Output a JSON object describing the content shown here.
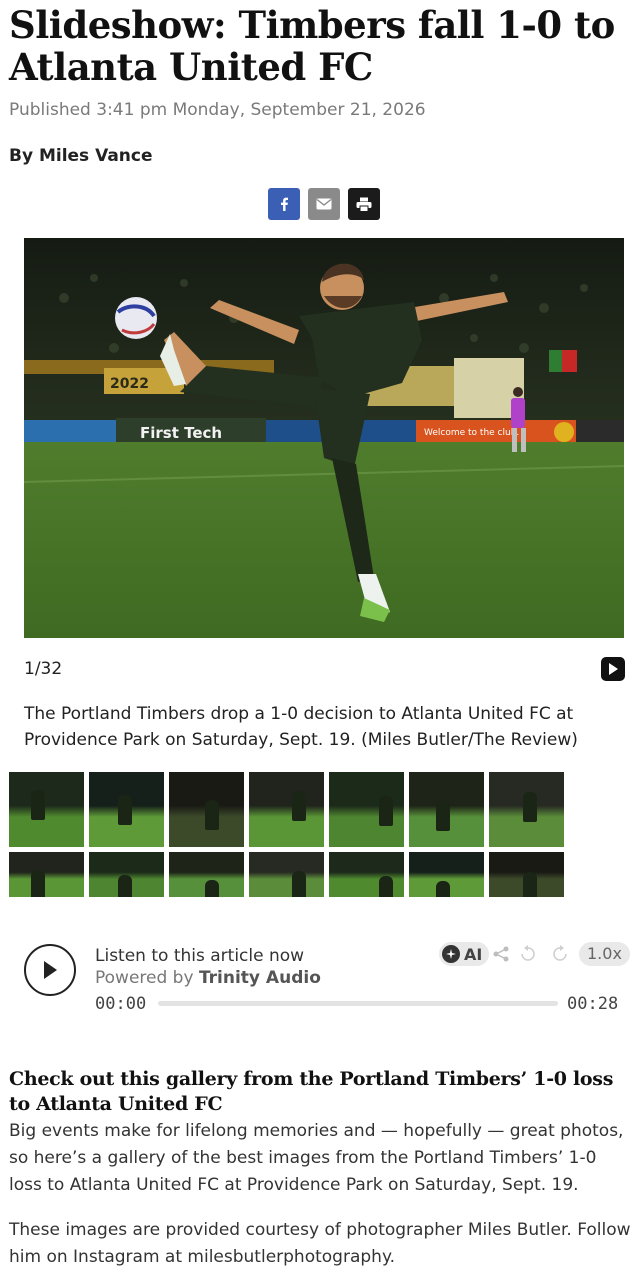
{
  "article": {
    "title": "Slideshow: Timbers fall 1-0 to Atlanta United FC",
    "published": "Published 3:41 pm Monday, September 21, 2026",
    "byline": "By Miles Vance"
  },
  "share": {
    "facebook_icon": "facebook-icon",
    "email_icon": "email-icon",
    "print_icon": "print-icon",
    "colors": {
      "facebook": "#3b5fb5",
      "email": "#8a8a8a",
      "print": "#1b1b1b"
    }
  },
  "gallery": {
    "counter": "1/32",
    "caption": "The Portland Timbers drop a 1-0 decision to Atlanta United FC at Providence Park on Saturday, Sept. 19. (Miles Butler/The Review)",
    "main_image": {
      "board_left": "First Tech",
      "board_year": "2022",
      "fence_text": "Welcome to the club."
    },
    "thumbnails_row1": [
      "thumb-1",
      "thumb-2",
      "thumb-3",
      "thumb-4",
      "thumb-5",
      "thumb-6",
      "thumb-7"
    ],
    "thumbnails_row2": [
      "thumb-8",
      "thumb-9",
      "thumb-10",
      "thumb-11",
      "thumb-12",
      "thumb-13",
      "thumb-14"
    ]
  },
  "audio_player": {
    "listen_label": "Listen to this article now",
    "powered_prefix": "Powered by",
    "powered_brand": "Trinity Audio",
    "current_time": "00:00",
    "total_time": "00:28",
    "progress": 0,
    "ai_label": "AI",
    "speed": "1.0x"
  },
  "body": {
    "subhead": "Check out this gallery from the Portland Timbers’ 1-0 loss to Atlanta United FC",
    "paragraph1": "Big events make for lifelong memories and — hopefully — great photos, so here’s a gallery of the best images from the Portland Timbers’ 1-0 loss to Atlanta United FC at Providence Park on Saturday, Sept. 19.",
    "paragraph2": "These images are provided courtesy of photographer Miles Butler. Follow him on Instagram at milesbutlerphotography."
  }
}
